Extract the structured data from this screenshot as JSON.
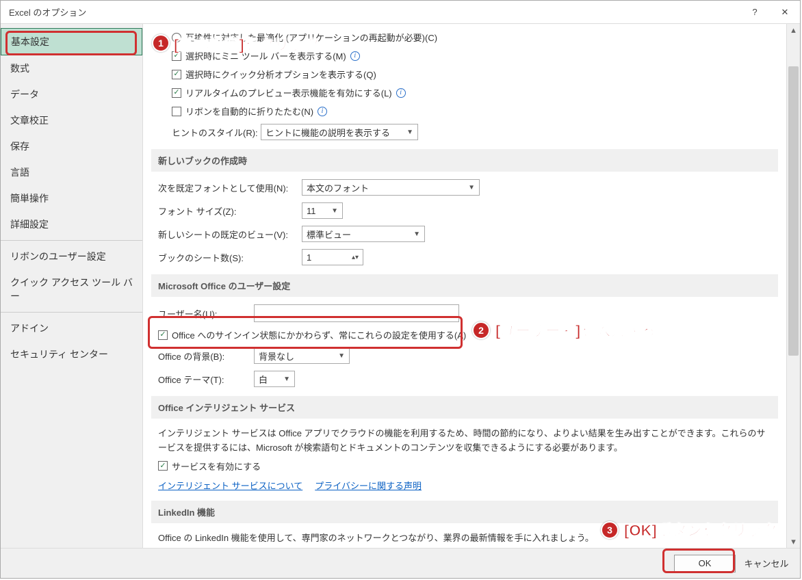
{
  "titlebar": {
    "title": "Excel のオプション"
  },
  "sidebar": {
    "items": [
      {
        "label": "基本設定",
        "selected": true
      },
      {
        "label": "数式"
      },
      {
        "label": "データ"
      },
      {
        "label": "文章校正"
      },
      {
        "label": "保存"
      },
      {
        "label": "言語"
      },
      {
        "label": "簡単操作"
      },
      {
        "label": "詳細設定"
      },
      {
        "sep": true
      },
      {
        "label": "リボンのユーザー設定"
      },
      {
        "label": "クイック アクセス ツール バー"
      },
      {
        "sep": true
      },
      {
        "label": "アドイン"
      },
      {
        "label": "セキュリティ センター"
      }
    ]
  },
  "content": {
    "compat_radio": "互換性に対応した最適化 (アプリケーションの再起動が必要)(C)",
    "chk_mini": "選択時にミニ ツール バーを表示する(M)",
    "chk_quick": "選択時にクイック分析オプションを表示する(Q)",
    "chk_preview": "リアルタイムのプレビュー表示機能を有効にする(L)",
    "chk_ribbon": "リボンを自動的に折りたたむ(N)",
    "hint_label": "ヒントのスタイル(R):",
    "hint_value": "ヒントに機能の説明を表示する",
    "sec_new": "新しいブックの作成時",
    "font_label": "次を既定フォントとして使用(N):",
    "font_value": "本文のフォント",
    "size_label": "フォント サイズ(Z):",
    "size_value": "11",
    "view_label": "新しいシートの既定のビュー(V):",
    "view_value": "標準ビュー",
    "sheets_label": "ブックのシート数(S):",
    "sheets_value": "1",
    "sec_user": "Microsoft Office のユーザー設定",
    "user_label": "ユーザー名(U):",
    "user_value": "",
    "chk_always": "Office へのサインイン状態にかかわらず、常にこれらの設定を使用する(A)",
    "bg_label": "Office の背景(B):",
    "bg_value": "背景なし",
    "theme_label": "Office テーマ(T):",
    "theme_value": "白",
    "sec_intel": "Office インテリジェント サービス",
    "intel_desc": "インテリジェント サービスは Office アプリでクラウドの機能を利用するため、時間の節約になり、よりよい結果を生み出すことができます。これらのサービスを提供するには、Microsoft が検索語句とドキュメントのコンテンツを収集できるようにする必要があります。",
    "chk_intel": "サービスを有効にする",
    "link_intel": "インテリジェント サービスについて",
    "link_privacy": "プライバシーに関する声明",
    "sec_linkedin": "LinkedIn 機能",
    "linkedin_desc": "Office の LinkedIn 機能を使用して、専門家のネットワークとつながり、業界の最新情報を手に入れましょう。"
  },
  "footer": {
    "ok": "OK",
    "cancel": "キャンセル"
  },
  "annotations": {
    "a1": "[基本設定]をクリック",
    "a2": "[ユーザー名]を入力する",
    "a3": "[OK]ボタンをクリック",
    "n1": "1",
    "n2": "2",
    "n3": "3"
  }
}
